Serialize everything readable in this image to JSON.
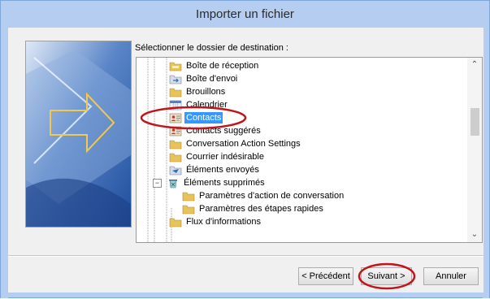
{
  "window": {
    "title": "Importer un fichier"
  },
  "prompt": "Sélectionner le dossier de destination :",
  "tree": {
    "items": [
      {
        "label": "Boîte de réception"
      },
      {
        "label": "Boîte d'envoi"
      },
      {
        "label": "Brouillons"
      },
      {
        "label": "Calendrier"
      },
      {
        "label": "Contacts"
      },
      {
        "label": "Contacts suggérés"
      },
      {
        "label": "Conversation Action Settings"
      },
      {
        "label": "Courrier indésirable"
      },
      {
        "label": "Éléments envoyés"
      },
      {
        "label": "Éléments supprimés",
        "expanded": true
      },
      {
        "label": "Paramètres d'action de conversation"
      },
      {
        "label": "Paramètres des étapes rapides"
      },
      {
        "label": "Flux d'informations"
      }
    ],
    "selected": "Contacts",
    "expander_symbol": "−"
  },
  "scrollbar": {
    "up_arrow": "⌃",
    "down_arrow": "⌄"
  },
  "buttons": {
    "previous": "< Précédent",
    "next": "Suivant >",
    "cancel": "Annuler"
  },
  "colors": {
    "title_bar": "#b4cdf0",
    "selection": "#3399ff",
    "annotation": "#c0151b",
    "folder": "#e8c35a"
  },
  "icons": {
    "folder": "folder-icon",
    "contacts": "contacts-icon",
    "calendar": "calendar-icon",
    "inbox": "inbox-icon",
    "outbox": "outbox-icon",
    "deleted": "deleted-items-icon",
    "sent": "sent-items-icon"
  }
}
